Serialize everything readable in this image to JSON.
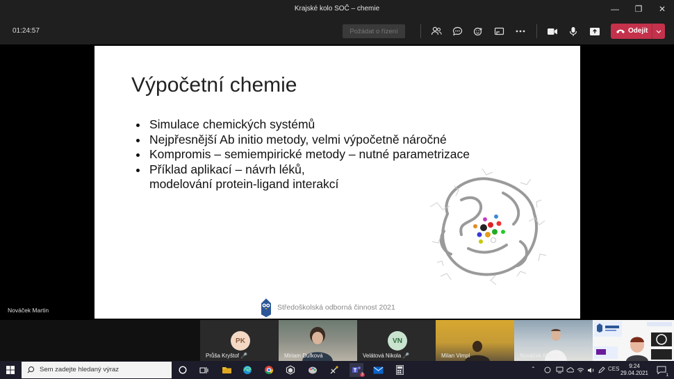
{
  "window": {
    "title": "Krajské kolo SOČ – chemie"
  },
  "toolbar": {
    "elapsed": "01:24:57",
    "request_control": "Požádat o řízení",
    "leave_label": "Odejít",
    "leave_color": "#c4314b"
  },
  "slide": {
    "title": "Výpočetní chemie",
    "bullets": [
      "Simulace chemických systémů",
      "Nejpřesnější Ab initio metody, velmi výpočetně náročné",
      "Kompromis – semiempirické metody – nutné parametrizace",
      "Příklad aplikací – návrh léků,"
    ],
    "bullet_continuation": "modelování protein-ligand interakcí",
    "footer": "Středoškolská odborná činnost 2021"
  },
  "presenter": {
    "name": "Nováček Martin"
  },
  "participants": [
    {
      "initials": "PK",
      "name": "Průša Kryštof",
      "avatar_color": "#f3d9c4",
      "text_color": "#8a5a3b"
    },
    {
      "initials": "",
      "name": "Miriam Dufková",
      "video": true
    },
    {
      "initials": "VN",
      "name": "Velátová Nikola",
      "avatar_color": "#c9e3cf",
      "text_color": "#2f6b3c"
    },
    {
      "initials": "",
      "name": "Milan Vimpl",
      "video": true
    },
    {
      "initials": "",
      "name": "Nováček Martin",
      "video": true
    },
    {
      "initials": "",
      "name": "",
      "video": true
    }
  ],
  "taskbar": {
    "search_placeholder": "Sem zadejte hledaný výraz",
    "language": "CES",
    "time": "9:24",
    "date": "29.04.2021",
    "notification_count": "1",
    "teams_badge": "3"
  }
}
